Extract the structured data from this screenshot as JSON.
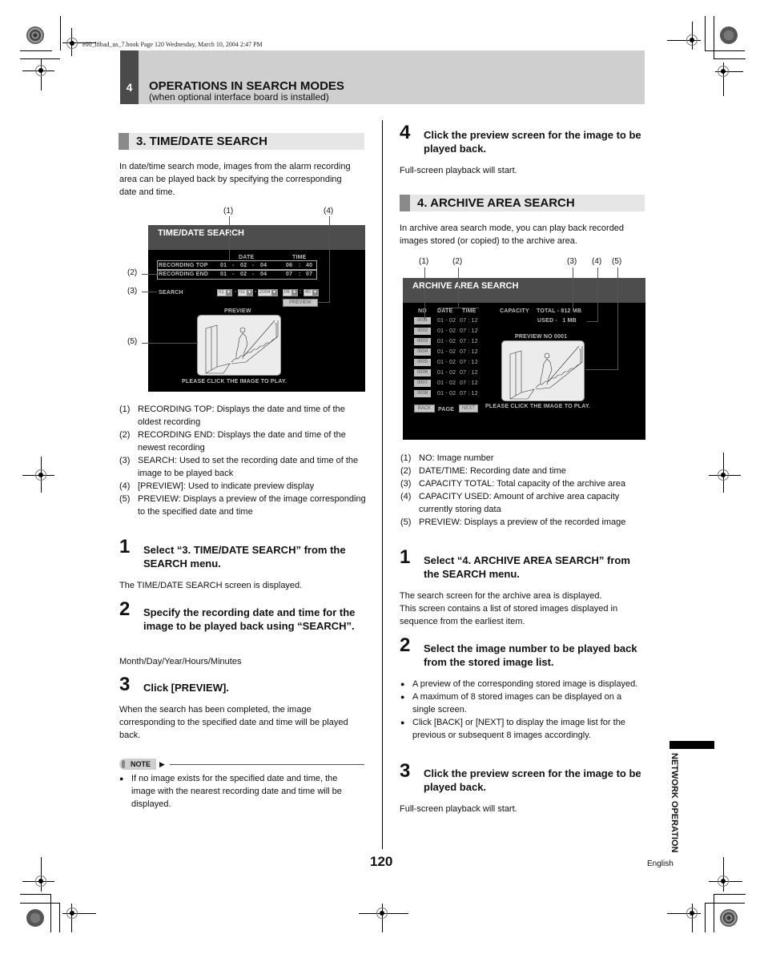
{
  "print_info": "e00_l8had_us_7.book  Page 120  Wednesday, March 10, 2004  2:47 PM",
  "chapter": {
    "number": "4",
    "title": "OPERATIONS IN SEARCH MODES",
    "subtitle": "(when optional interface board is installed)"
  },
  "left": {
    "section_title": "3. TIME/DATE SEARCH",
    "intro": "In date/time search mode, images from the alarm recording area can be played back by specifying the corresponding date and time.",
    "screen": {
      "title": "TIME/DATE SEARCH",
      "col_date": "DATE",
      "col_time": "TIME",
      "rows": [
        {
          "label": "RECORDING TOP",
          "m": "01",
          "d": "02",
          "y": "04",
          "hh": "06",
          "mm": "40"
        },
        {
          "label": "RECORDING END",
          "m": "01",
          "d": "02",
          "y": "04",
          "hh": "07",
          "mm": "07"
        }
      ],
      "search_label": "SEARCH",
      "search": {
        "month": "01",
        "day": "02",
        "year": "2004",
        "hour": "06",
        "minute": "40"
      },
      "preview_button": "PREVIEW",
      "preview_label": "PREVIEW",
      "click_hint": "PLEASE CLICK THE IMAGE TO PLAY.",
      "callouts": [
        "(1)",
        "(2)",
        "(3)",
        "(4)",
        "(5)"
      ]
    },
    "legend": [
      {
        "n": "(1)",
        "text": "RECORDING TOP: Displays the date and time of the oldest recording"
      },
      {
        "n": "(2)",
        "text": "RECORDING END: Displays the date and time of the newest recording"
      },
      {
        "n": "(3)",
        "text": "SEARCH: Used to set the recording date and time of the image to be played back"
      },
      {
        "n": "(4)",
        "text": "[PREVIEW]: Used to indicate preview display"
      },
      {
        "n": "(5)",
        "text": "PREVIEW: Displays a preview of the image corresponding to the specified date and time"
      }
    ],
    "steps": [
      {
        "n": "1",
        "title": "Select “3. TIME/DATE SEARCH” from the SEARCH menu.",
        "body": "The TIME/DATE SEARCH screen is displayed."
      },
      {
        "n": "2",
        "title": "Specify the recording date and time for the image to be played back using “SEARCH”.",
        "body": "Month/Day/Year/Hours/Minutes"
      },
      {
        "n": "3",
        "title": "Click [PREVIEW].",
        "body": "When the search has been completed, the image corresponding to the specified date and time will be played back."
      }
    ],
    "note_label": "NOTE",
    "note_items": [
      "If no image exists for the specified date and time, the image with the nearest recording date and time will be displayed."
    ]
  },
  "right": {
    "step4": {
      "n": "4",
      "title": "Click the preview screen for the image to be played back.",
      "body": "Full-screen playback will start."
    },
    "section_title": "4. ARCHIVE AREA SEARCH",
    "intro": "In archive area search mode, you can play back recorded images stored (or copied) to the archive area.",
    "screen": {
      "title": "ARCHIVE AREA SEARCH",
      "col_no": "NO",
      "col_date": "DATE",
      "col_time": "TIME",
      "capacity_label": "CAPACITY",
      "total": "TOTAL - 812 MB",
      "used": "USED -   1 MB",
      "preview_no": "PREVIEW NO 0001",
      "rows": [
        {
          "no": "0001",
          "date": "01 - 02",
          "time": "07 : 12"
        },
        {
          "no": "0002",
          "date": "01 - 02",
          "time": "07 : 12"
        },
        {
          "no": "0003",
          "date": "01 - 02",
          "time": "07 : 12"
        },
        {
          "no": "0004",
          "date": "01 - 02",
          "time": "07 : 12"
        },
        {
          "no": "0005",
          "date": "01 - 02",
          "time": "07 : 12"
        },
        {
          "no": "0006",
          "date": "01 - 02",
          "time": "07 : 12"
        },
        {
          "no": "0007",
          "date": "01 - 02",
          "time": "07 : 12"
        },
        {
          "no": "0008",
          "date": "01 - 02",
          "time": "07 : 12"
        }
      ],
      "back": "BACK",
      "page": "PAGE",
      "next": "NEXT",
      "click_hint": "PLEASE CLICK THE IMAGE TO PLAY.",
      "callouts": [
        "(1)",
        "(2)",
        "(3)",
        "(4)",
        "(5)"
      ]
    },
    "legend": [
      {
        "n": "(1)",
        "text": "NO: Image number"
      },
      {
        "n": "(2)",
        "text": "DATE/TIME: Recording date and time"
      },
      {
        "n": "(3)",
        "text": "CAPACITY TOTAL: Total capacity of the archive area"
      },
      {
        "n": "(4)",
        "text": "CAPACITY USED: Amount of archive area capacity currently storing data"
      },
      {
        "n": "(5)",
        "text": "PREVIEW: Displays a preview of the recorded image"
      }
    ],
    "steps": [
      {
        "n": "1",
        "title": "Select “4. ARCHIVE AREA SEARCH” from the SEARCH menu.",
        "body": "The search screen for the archive area is displayed.\nThis screen contains a list of stored images displayed in sequence from the earliest item."
      },
      {
        "n": "2",
        "title": "Select the image number to be played back from the stored image list."
      },
      {
        "n": "3",
        "title": "Click the preview screen for the image to be played back.",
        "body": "Full-screen playback will start."
      }
    ],
    "step2_bullets": [
      "A preview of the corresponding stored image is displayed.",
      "A maximum of 8 stored images can be displayed on a single screen.",
      "Click [BACK] or [NEXT] to display the image list for the previous or subsequent 8 images accordingly."
    ]
  },
  "side_tab": "NETWORK OPERATION",
  "page_number": "120",
  "language": "English"
}
